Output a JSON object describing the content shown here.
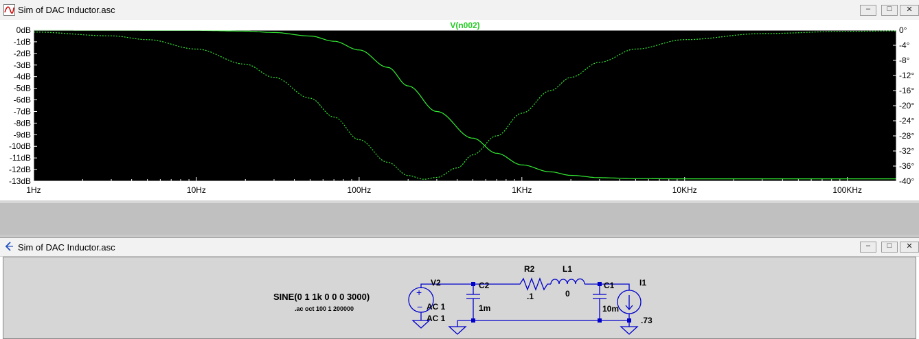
{
  "plot_window": {
    "title": "Sim of DAC Inductor.asc",
    "trace_label": "V(n002)",
    "buttons": {
      "minimize": "–",
      "maximize": "□",
      "close": "✕"
    }
  },
  "schematic_window": {
    "title": "Sim of DAC Inductor.asc",
    "buttons": {
      "minimize": "–",
      "maximize": "□",
      "close": "✕"
    },
    "directive_sine": "SINE(0 1 1k 0 0 0 3000)",
    "directive_ac": ".ac oct 100 1 200000",
    "components": {
      "v2_name": "V2",
      "v2_ac1": "AC 1",
      "v2_ac2": "AC 1",
      "c2_name": "C2",
      "c2_value": "1m",
      "r2_name": "R2",
      "r2_value": ".1",
      "l1_name": "L1",
      "l1_value": "0",
      "c1_name": "C1",
      "c1_value": "10m",
      "i1_name": "I1",
      "i1_value": ".73"
    }
  },
  "chart_data": {
    "type": "line",
    "title": "V(n002)",
    "x_scale": "log",
    "x_ticks": [
      "1Hz",
      "10Hz",
      "100Hz",
      "1KHz",
      "10KHz",
      "100KHz"
    ],
    "x_tick_values": [
      1,
      10,
      100,
      1000,
      10000,
      100000
    ],
    "xlim": [
      1,
      200000
    ],
    "y_ticks_left": [
      "0dB",
      "-1dB",
      "-2dB",
      "-3dB",
      "-4dB",
      "-5dB",
      "-6dB",
      "-7dB",
      "-8dB",
      "-9dB",
      "-10dB",
      "-11dB",
      "-12dB",
      "-13dB"
    ],
    "ylim_left": [
      -13,
      0
    ],
    "y_ticks_right": [
      "0°",
      "-4°",
      "-8°",
      "-12°",
      "-16°",
      "-20°",
      "-24°",
      "-28°",
      "-32°",
      "-36°",
      "-40°"
    ],
    "ylim_right": [
      -40,
      0
    ],
    "grid": false,
    "colors": {
      "background": "#000000",
      "trace": "#33ee33",
      "axis": "#ffffff",
      "label": "#33ee33"
    },
    "series": [
      {
        "name": "V(n002)",
        "quantity": "magnitude",
        "axis": "left",
        "style": "solid",
        "x": [
          1,
          10,
          20,
          30,
          50,
          70,
          100,
          150,
          200,
          300,
          500,
          700,
          1000,
          1500,
          2000,
          3000,
          5000,
          10000,
          100000,
          200000
        ],
        "y": [
          0,
          -0.02,
          -0.08,
          -0.2,
          -0.5,
          -0.95,
          -1.7,
          -3.2,
          -4.8,
          -7.0,
          -9.3,
          -10.6,
          -11.6,
          -12.2,
          -12.5,
          -12.7,
          -12.78,
          -12.8,
          -12.8,
          -12.8
        ]
      },
      {
        "name": "V(n002)",
        "quantity": "phase",
        "axis": "right",
        "style": "dotted",
        "x": [
          1,
          3,
          5,
          10,
          20,
          30,
          50,
          70,
          100,
          150,
          200,
          250,
          300,
          400,
          500,
          700,
          1000,
          1500,
          2000,
          3000,
          5000,
          10000,
          30000,
          100000,
          200000
        ],
        "y": [
          -0.5,
          -1.5,
          -2.5,
          -5,
          -9,
          -12.5,
          -18,
          -23,
          -29,
          -35,
          -38.5,
          -39.5,
          -39,
          -36.5,
          -33,
          -28,
          -22,
          -16,
          -12.5,
          -8.5,
          -5,
          -2.5,
          -0.9,
          -0.3,
          -0.2
        ]
      }
    ]
  }
}
